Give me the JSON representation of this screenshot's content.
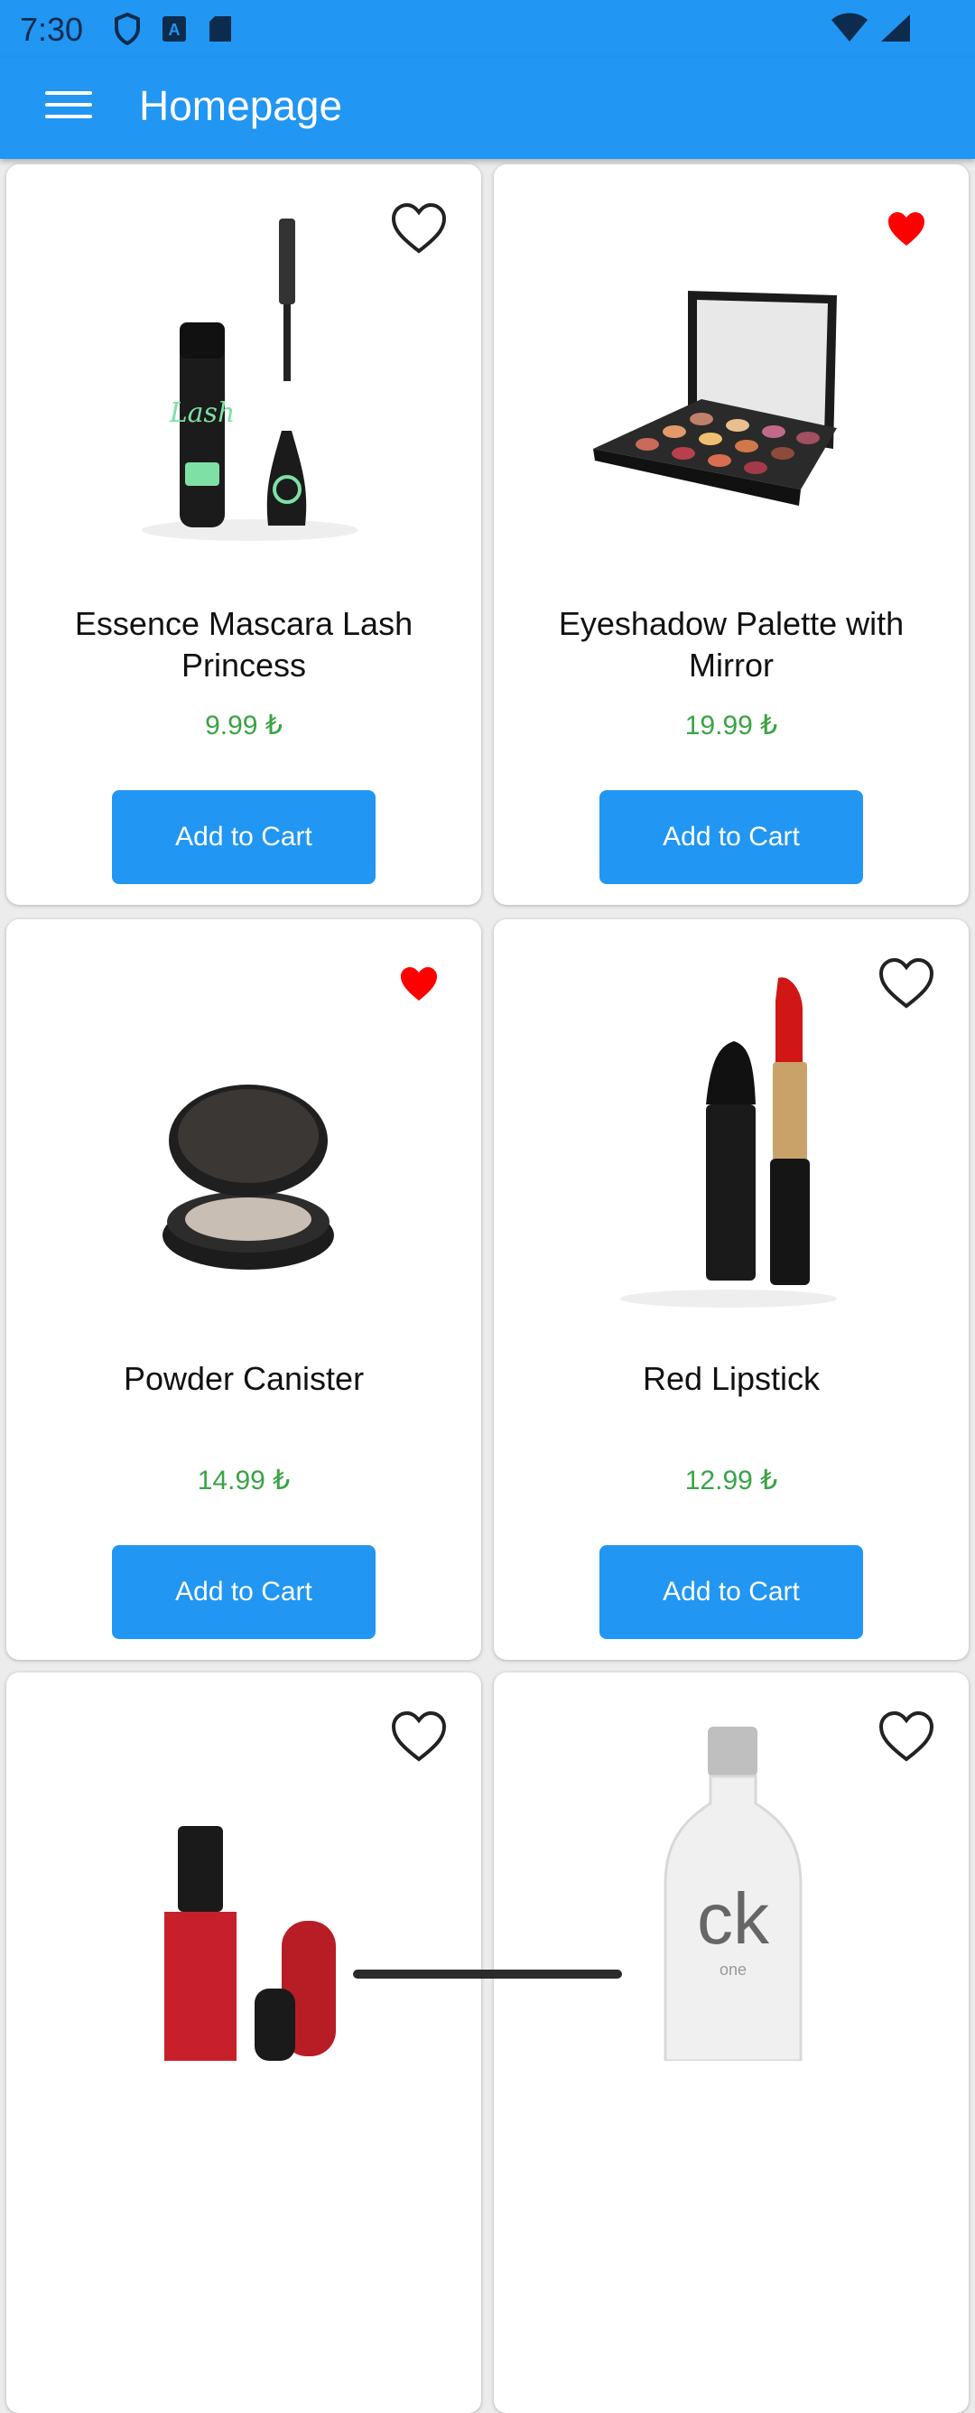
{
  "status_bar": {
    "time": "7:30",
    "icons_left": [
      "shield-icon",
      "a-badge-icon",
      "sd-card-icon"
    ],
    "icons_right": [
      "wifi-icon",
      "signal-icon"
    ]
  },
  "app_bar": {
    "title": "Homepage",
    "menu_icon": "hamburger-menu-icon"
  },
  "colors": {
    "primary": "#2196f3",
    "price": "#3aa344",
    "favorite_active": "#ff0000"
  },
  "products": [
    {
      "name": "Essence Mascara Lash Princess",
      "price": "9.99 ₺",
      "button": "Add to Cart",
      "favorite": false,
      "image": "mascara"
    },
    {
      "name": "Eyeshadow Palette with Mirror",
      "price": "19.99 ₺",
      "button": "Add to Cart",
      "favorite": true,
      "image": "eyeshadow-palette"
    },
    {
      "name": "Powder Canister",
      "price": "14.99 ₺",
      "button": "Add to Cart",
      "favorite": true,
      "image": "powder-compact"
    },
    {
      "name": "Red Lipstick",
      "price": "12.99 ₺",
      "button": "Add to Cart",
      "favorite": false,
      "image": "lipstick"
    },
    {
      "name": "",
      "price": "",
      "button": "",
      "favorite": false,
      "image": "nail-polish"
    },
    {
      "name": "",
      "price": "",
      "button": "",
      "favorite": false,
      "image": "perfume-bottle",
      "image_text": "ck",
      "image_subtext": "one"
    }
  ]
}
